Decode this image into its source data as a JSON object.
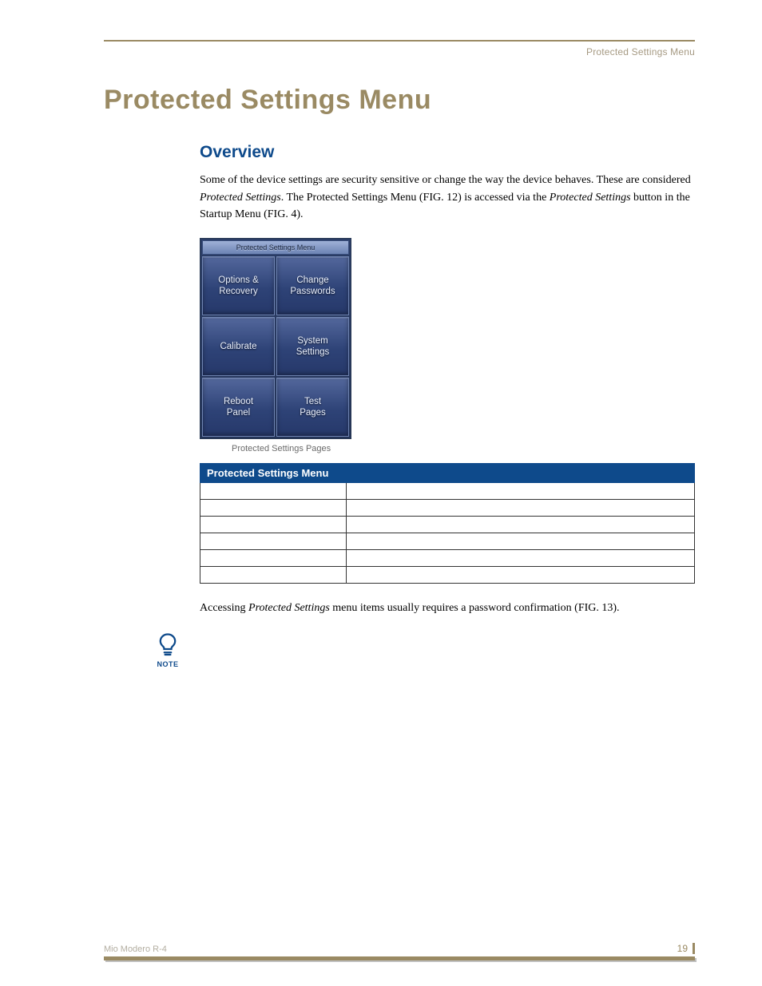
{
  "header": {
    "running_head": "Protected Settings Menu"
  },
  "title": "Protected Settings Menu",
  "overview": {
    "heading": "Overview",
    "para_parts": {
      "p1a": "Some of the device settings are security sensitive or change the way the device behaves. These are considered ",
      "p1b": "Protected Settings",
      "p1c": ". The Protected Settings Menu (FIG. 12) is accessed via the ",
      "p1d": "Protected Settings",
      "p1e": " button in the Startup Menu (FIG. 4)."
    }
  },
  "menu_panel": {
    "titlebar": "Protected Settings Menu",
    "buttons": {
      "r0c0a": "Options &",
      "r0c0b": "Recovery",
      "r0c1a": "Change",
      "r0c1b": "Passwords",
      "r1c0a": "Calibrate",
      "r1c0b": "",
      "r1c1a": "System",
      "r1c1b": "Settings",
      "r2c0a": "Reboot",
      "r2c0b": "Panel",
      "r2c1a": "Test",
      "r2c1b": "Pages"
    },
    "caption": "Protected Settings Pages"
  },
  "options_table": {
    "header": "Protected Settings Menu",
    "rows": [
      {
        "name": "",
        "desc": ""
      },
      {
        "name": "",
        "desc": ""
      },
      {
        "name": "",
        "desc": ""
      },
      {
        "name": "",
        "desc": ""
      },
      {
        "name": "",
        "desc": ""
      },
      {
        "name": "",
        "desc": ""
      }
    ]
  },
  "after_table": {
    "a": "Accessing ",
    "b": "Protected Settings",
    "c": " menu items usually requires a password confirmation (FIG. 13)."
  },
  "note": {
    "label": "NOTE"
  },
  "footer": {
    "doc": "Mio Modero R-4",
    "page": "19"
  }
}
